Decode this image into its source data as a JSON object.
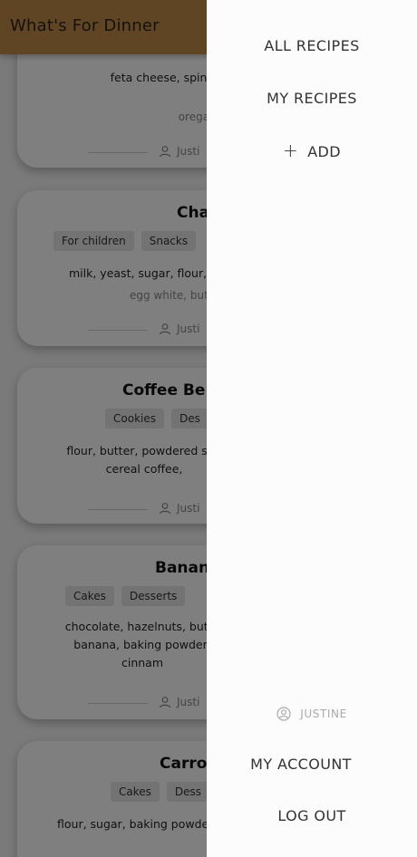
{
  "app": {
    "title": "What's For Dinner"
  },
  "recipes": [
    {
      "title": "",
      "tags": [],
      "ingredients": "feta cheese, spinach, béchamel sau",
      "extra": "oregano, g",
      "author": "Justi"
    },
    {
      "title": "Cha",
      "tags": [
        "For children",
        "Snacks"
      ],
      "ingredients": "milk, yeast, sugar, flour, e",
      "extra": "egg white, butt",
      "author": "Justi"
    },
    {
      "title": "Coffee Be",
      "tags": [
        "Cookies",
        "Des"
      ],
      "ingredients": "flour, butter, powdered sug cereal coffee,",
      "extra": "",
      "author": "Justi"
    },
    {
      "title": "Banan",
      "tags": [
        "Cakes",
        "Desserts"
      ],
      "ingredients": "chocolate, hazelnuts, butte banana, baking powder, cinnam",
      "extra": "",
      "author": "Justi"
    },
    {
      "title": "Carro",
      "tags": [
        "Cakes",
        "Dess"
      ],
      "ingredients": "flour, sugar, baking powde",
      "extra": "",
      "author": ""
    }
  ],
  "drawer": {
    "all_recipes": "ALL RECIPES",
    "my_recipes": "MY RECIPES",
    "add": "ADD",
    "user": "JUSTINE",
    "my_account": "MY ACCOUNT",
    "log_out": "LOG OUT"
  },
  "colors": {
    "app_bar": "#c18a4a",
    "drawer_bg": "#fdfcfc"
  }
}
